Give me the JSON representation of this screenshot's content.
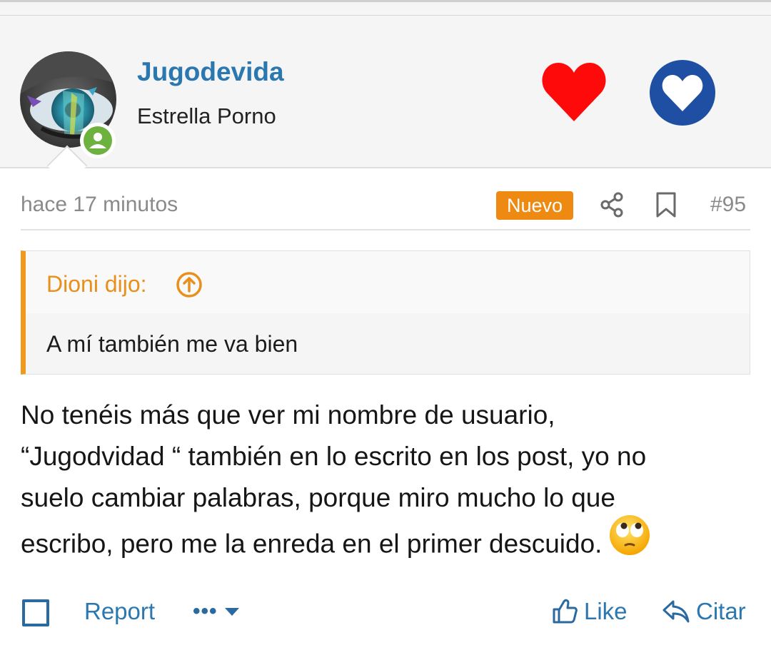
{
  "user": {
    "name": "Jugodevida",
    "title": "Estrella Porno",
    "status": "online"
  },
  "reactions": [
    {
      "icon": "red-heart-icon",
      "color": "#ff0a0a"
    },
    {
      "icon": "blue-heart-icon",
      "color": "#1f4fa3"
    }
  ],
  "post": {
    "timestamp": "hace 17 minutos",
    "badge": "Nuevo",
    "number": "#95",
    "quote": {
      "author": "Dioni dijo:",
      "text": "A mí también me va bien"
    },
    "body_lines": [
      "No tenéis más que ver mi nombre de usuario,",
      "“Jugodvidad “ también en lo escrito en los post, yo no",
      "suelo cambiar palabras, porque miro mucho lo que",
      "escribo, pero me la enreda en el primer descuido."
    ],
    "emoji": "face-with-rolling-eyes"
  },
  "actions": {
    "report": "Report",
    "more": "•••",
    "like": "Like",
    "quote": "Citar"
  },
  "colors": {
    "link": "#2b77b0",
    "badge": "#ee8a12",
    "quote_accent": "#ee9a1f",
    "online": "#6db23e"
  }
}
